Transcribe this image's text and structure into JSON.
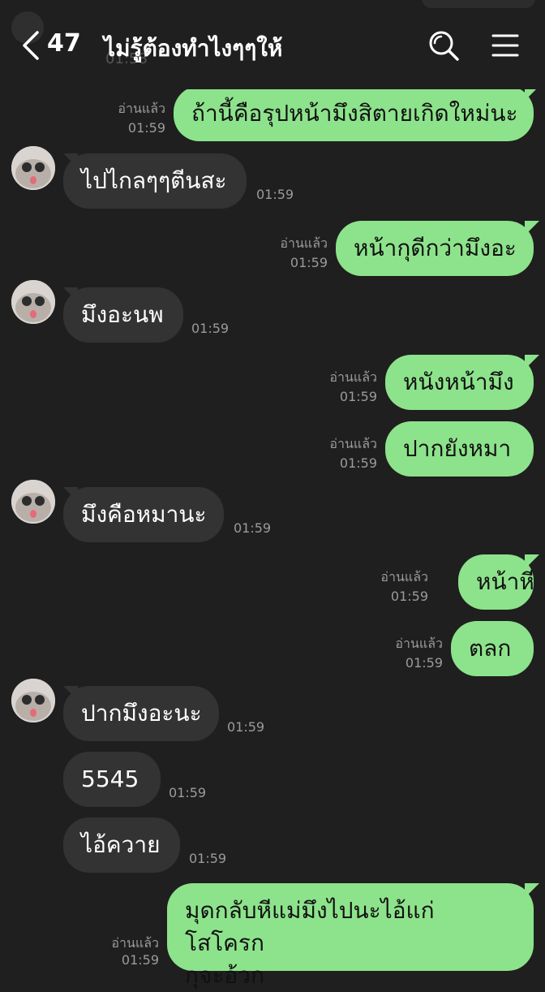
{
  "header": {
    "back_count": "47",
    "title": "ไม่รู้ต้องทำไงๆๆให้",
    "ghost_time": "01:58"
  },
  "labels": {
    "read": "อ่านแล้ว"
  },
  "messages": [
    {
      "dir": "out",
      "text": "ถ้านี้คือรุปหน้ามึงสิตายเกิดใหม่นะ",
      "time": "01:59"
    },
    {
      "dir": "in",
      "text": "ไปไกลๆๆตีนสะ",
      "time": "01:59"
    },
    {
      "dir": "out",
      "text": "หน้ากุดีกว่ามึงอะ",
      "time": "01:59"
    },
    {
      "dir": "in",
      "text": "มึงอะนพ",
      "time": "01:59"
    },
    {
      "dir": "out",
      "text": "หนังหน้ามึง",
      "time": "01:59"
    },
    {
      "dir": "out",
      "text": "ปากยังหมา",
      "time": "01:59"
    },
    {
      "dir": "in",
      "text": "มึงคือหมานะ",
      "time": "01:59"
    },
    {
      "dir": "out",
      "text": "หน้าหี",
      "time": "01:59"
    },
    {
      "dir": "out",
      "text": "ตลก",
      "time": "01:59"
    },
    {
      "dir": "in",
      "text": "ปากมึงอะนะ",
      "time": "01:59"
    },
    {
      "dir": "in",
      "text": "5545",
      "time": "01:59"
    },
    {
      "dir": "in",
      "text": "ไอ้ควาย",
      "time": "01:59"
    },
    {
      "dir": "out",
      "text_line1": "มุดกลับหีแม่มึงไปนะไอ้แก่ โสโครก",
      "text_line2": "กุจะอ้วก",
      "time": "01:59"
    }
  ],
  "colors": {
    "background": "#1f1f1f",
    "outgoing_bubble": "#8de38b",
    "incoming_bubble": "#333333",
    "meta_text": "#9b9b9b"
  }
}
